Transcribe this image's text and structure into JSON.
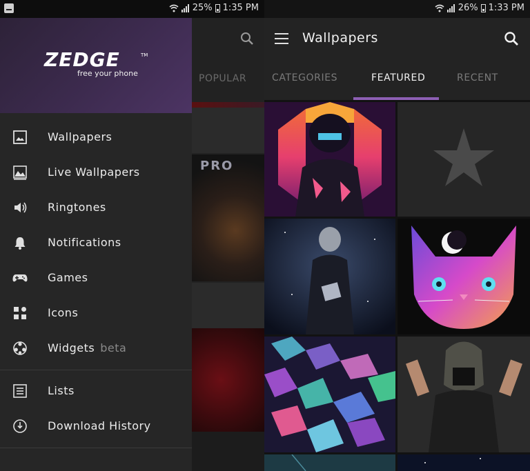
{
  "left": {
    "status": {
      "battery": "25%",
      "time": "1:35 PM"
    },
    "behind": {
      "tab": "POPULAR",
      "tile_text": "PRO"
    },
    "drawer": {
      "logo": {
        "word": "ZEDGE",
        "tm": "TM",
        "tagline": "free your phone"
      },
      "menu": [
        {
          "label": "Wallpapers",
          "icon": "image-icon"
        },
        {
          "label": "Live Wallpapers",
          "icon": "landscape-icon"
        },
        {
          "label": "Ringtones",
          "icon": "speaker-icon"
        },
        {
          "label": "Notifications",
          "icon": "bell-icon"
        },
        {
          "label": "Games",
          "icon": "gamepad-icon"
        },
        {
          "label": "Icons",
          "icon": "grid-icon"
        },
        {
          "label": "Widgets",
          "badge": "beta",
          "icon": "widget-icon"
        },
        {
          "label": "Lists",
          "icon": "list-icon"
        },
        {
          "label": "Download History",
          "icon": "history-icon"
        }
      ]
    }
  },
  "right": {
    "status": {
      "battery": "26%",
      "time": "1:33 PM"
    },
    "toolbar": {
      "title": "Wallpapers"
    },
    "tabs": [
      {
        "label": "CATEGORIES",
        "active": false
      },
      {
        "label": "FEATURED",
        "active": true
      },
      {
        "label": "RECENT",
        "active": false
      }
    ],
    "accent": "#8d5fb4"
  }
}
